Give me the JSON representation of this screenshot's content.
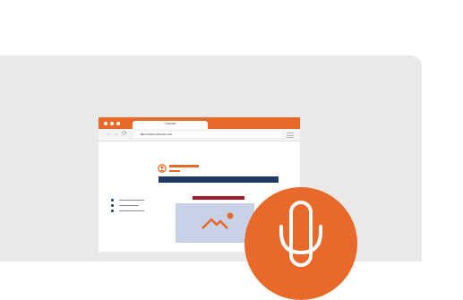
{
  "browser": {
    "tab_title": "Colorado",
    "url": "https://www.colorado.com",
    "nav": {
      "back": "←",
      "forward": "→",
      "reload": "⟳"
    }
  },
  "icons": {
    "menu": "hamburger-icon",
    "avatar": "user-icon",
    "image": "image-placeholder-icon",
    "microphone": "microphone-icon"
  },
  "colors": {
    "accent": "#e8692a",
    "navy": "#1f3864",
    "red": "#a3182b",
    "panel": "#ebe8e8"
  }
}
